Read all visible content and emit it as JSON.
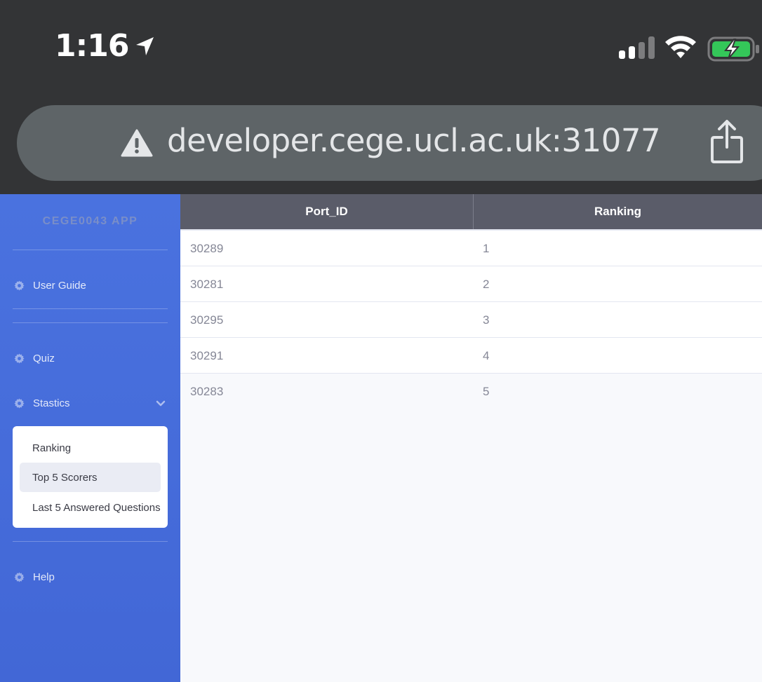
{
  "status_bar": {
    "time": "1:16"
  },
  "browser": {
    "url": "developer.cege.ucl.ac.uk:31077"
  },
  "sidebar": {
    "brand": "CEGE0043 APP",
    "items": [
      {
        "label": "User Guide",
        "icon": "gear-icon"
      },
      {
        "label": "Quiz",
        "icon": "gear-icon"
      },
      {
        "label": "Stastics",
        "icon": "gear-icon",
        "expanded": true
      },
      {
        "label": "Help",
        "icon": "gear-icon"
      }
    ],
    "submenu": [
      {
        "label": "Ranking",
        "active": false
      },
      {
        "label": "Top 5 Scorers",
        "active": true
      },
      {
        "label": "Last 5 Answered Questions",
        "active": false
      }
    ]
  },
  "table": {
    "headers": [
      "Port_ID",
      "Ranking"
    ],
    "rows": [
      [
        "30289",
        "1"
      ],
      [
        "30281",
        "2"
      ],
      [
        "30295",
        "3"
      ],
      [
        "30291",
        "4"
      ],
      [
        "30283",
        "5"
      ]
    ]
  },
  "colors": {
    "sidebar": "#4a72df",
    "table_header": "#5a5c69",
    "battery": "#34c759"
  }
}
